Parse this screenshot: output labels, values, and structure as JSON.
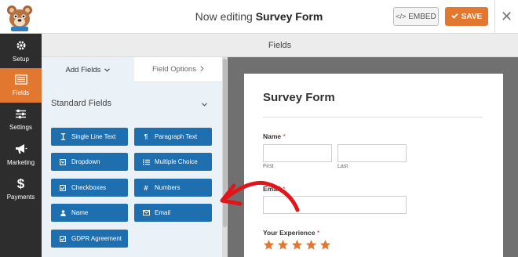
{
  "header": {
    "title_prefix": "Now editing",
    "form_name": "Survey Form",
    "embed_label": "EMBED",
    "save_label": "SAVE"
  },
  "sidebar": {
    "items": [
      {
        "label": "Setup",
        "icon": "gear-icon"
      },
      {
        "label": "Fields",
        "icon": "fields-list-icon",
        "active": true
      },
      {
        "label": "Settings",
        "icon": "sliders-icon"
      },
      {
        "label": "Marketing",
        "icon": "megaphone-icon"
      },
      {
        "label": "Payments",
        "icon": "dollar-icon"
      }
    ]
  },
  "panel": {
    "header": "Fields",
    "tabs": {
      "add": "Add Fields",
      "options": "Field Options"
    },
    "section": "Standard Fields",
    "buttons": [
      {
        "label": "Single Line Text",
        "icon": "text-cursor-icon"
      },
      {
        "label": "Paragraph Text",
        "icon": "paragraph-icon"
      },
      {
        "label": "Dropdown",
        "icon": "dropdown-icon"
      },
      {
        "label": "Multiple Choice",
        "icon": "list-icon"
      },
      {
        "label": "Checkboxes",
        "icon": "checkbox-icon"
      },
      {
        "label": "Numbers",
        "icon": "hash-icon"
      },
      {
        "label": "Name",
        "icon": "user-icon"
      },
      {
        "label": "Email",
        "icon": "envelope-icon"
      },
      {
        "label": "GDPR Agreement",
        "icon": "checkbox-icon"
      }
    ]
  },
  "form": {
    "title": "Survey Form",
    "name_label": "Name",
    "first_label": "First",
    "last_label": "Last",
    "email_label": "Email",
    "experience_label": "Your Experience",
    "required_mark": "*",
    "rating_stars": 5
  },
  "colors": {
    "accent": "#e27730",
    "button_blue": "#1e6fb0",
    "sidebar_bg": "#2d2d2d",
    "star": "#e27730",
    "annotation_arrow": "#e0161a"
  }
}
